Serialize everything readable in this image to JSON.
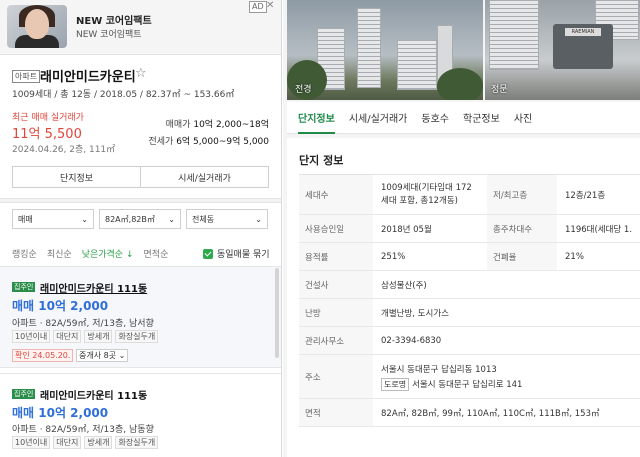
{
  "ad": {
    "title": "NEW 코어임팩트",
    "subtitle": "NEW 코어임팩트",
    "badge": "AD",
    "close": "✕"
  },
  "complex": {
    "type_tag": "아파트",
    "name": "래미안미드카운티",
    "meta": "1009세대 / 총 12동 / 2018.05 / 82.37㎡ ~ 153.66㎡",
    "recent_label": "최근 매매 실거래가",
    "recent_price": "11억 5,500",
    "recent_date": "2024.04.26, 2층, 111㎡",
    "sale_range_label": "매매가",
    "sale_range": "10억 2,000~18억",
    "jeonse_range_label": "전세가",
    "jeonse_range": "6억 5,000~9억 5,000",
    "btn_info": "단지정보",
    "btn_price": "시세/실거래가"
  },
  "filters": {
    "trade": "매매",
    "area": "82A㎡,82B㎡",
    "dong": "전체동"
  },
  "sort": {
    "items": [
      "랭킹순",
      "최신순",
      "낮은가격순",
      "면적순"
    ],
    "active_index": 2,
    "active_arrow": "↓",
    "group_label": "동일매물 묶기"
  },
  "listings": [
    {
      "tag": "집주인",
      "name": "래미안미드카운티 111동",
      "price": "매매 10억 2,000",
      "desc": "아파트 · 82A/59㎡, 저/13층, 남서향",
      "chips": [
        "10년이내",
        "대단지",
        "방세개",
        "화장실두개"
      ],
      "verify": "확인 24.05.20.",
      "agents": "중개사 8곳"
    },
    {
      "tag": "집주인",
      "name": "래미안미드카운티 111동",
      "price": "매매 10억 2,000",
      "desc": "아파트 · 82A/59㎡, 저/13층, 남동향",
      "chips": [
        "10년이내",
        "대단지",
        "방세개",
        "화장실두개"
      ]
    }
  ],
  "photos": {
    "label_left": "전경",
    "label_right": "정문",
    "sign": "RAEMIAN"
  },
  "tabs": [
    "단지정보",
    "시세/실거래가",
    "동호수",
    "학군정보",
    "사진"
  ],
  "info": {
    "title": "단지 정보",
    "rows": [
      {
        "k1": "세대수",
        "v1": "1009세대(기타임대 172세대 포함, 총12개동)",
        "k2": "저/최고층",
        "v2": "12층/21층"
      },
      {
        "k1": "사용승인일",
        "v1": "2018년 05월",
        "k2": "총주차대수",
        "v2": "1196대(세대당 1."
      },
      {
        "k1": "용적률",
        "v1": "251%",
        "k2": "건폐율",
        "v2": "21%"
      },
      {
        "k1": "건설사",
        "v1": "삼성물산(주)"
      },
      {
        "k1": "난방",
        "v1": "개별난방, 도시가스"
      },
      {
        "k1": "관리사무소",
        "v1": "02-3394-6830"
      },
      {
        "k1": "주소",
        "v1": "서울시 동대문구 답십리동 1013",
        "road_tag": "도로명",
        "v1b": "서울시 동대문구 답십리로 141"
      },
      {
        "k1": "면적",
        "v1": "82A㎡, 82B㎡, 99㎡, 110A㎡, 110C㎡, 111B㎡, 153㎡"
      }
    ]
  }
}
